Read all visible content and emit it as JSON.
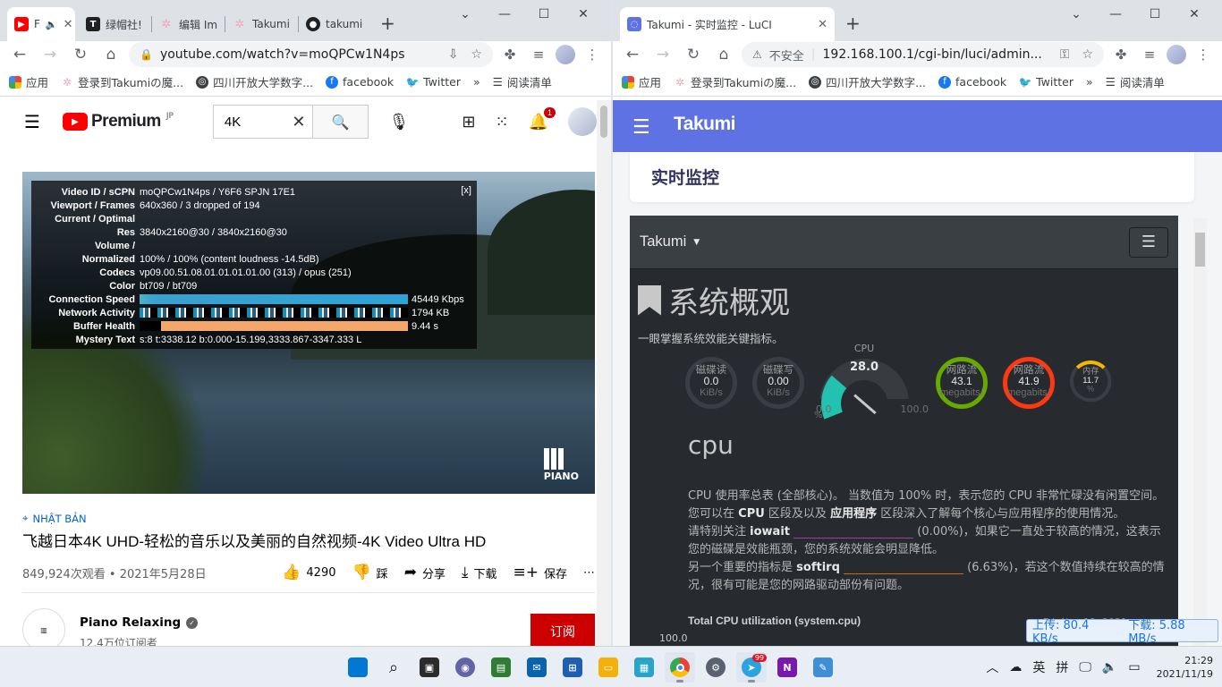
{
  "left_browser": {
    "tabs": [
      {
        "label": "F",
        "favicon_color": "#ff0000"
      },
      {
        "label": "绿帽社!",
        "favicon_color": "#202124"
      },
      {
        "label": "编辑 Im",
        "favicon_color": "#f4a7b9"
      },
      {
        "label": "Takumi",
        "favicon_color": "#f4a7b9"
      },
      {
        "label": "takumi",
        "favicon_color": "#202124"
      }
    ],
    "url": "youtube.com/watch?v=moQPCw1N4ps",
    "bookmarks": [
      "应用",
      "登录到Takumiの魔...",
      "四川开放大学数字...",
      "facebook",
      "Twitter"
    ],
    "reading_list": "阅读清单"
  },
  "youtube": {
    "logo_text": "Premium",
    "logo_region": "JP",
    "search_value": "4K",
    "notification_count": "1",
    "stats": [
      {
        "label": "Video ID / sCPN",
        "value": "moQPCw1N4ps / Y6F6 SPJN 17E1"
      },
      {
        "label": "Viewport / Frames",
        "value": "640x360 / 3 dropped of 194"
      },
      {
        "label": "Current / Optimal",
        "value": ""
      },
      {
        "label": "Res",
        "value": "3840x2160@30 / 3840x2160@30"
      },
      {
        "label": "Volume /",
        "value": ""
      },
      {
        "label": "Normalized",
        "value": "100% / 100% (content loudness -14.5dB)"
      },
      {
        "label": "Codecs",
        "value": "vp09.00.51.08.01.01.01.01.00 (313) / opus (251)"
      },
      {
        "label": "Color",
        "value": "bt709 / bt709"
      },
      {
        "label": "Connection Speed",
        "value": "45449 Kbps",
        "bar": "conn"
      },
      {
        "label": "Network Activity",
        "value": "1794 KB",
        "bar": "net"
      },
      {
        "label": "Buffer Health",
        "value": "9.44 s",
        "bar": "buf"
      },
      {
        "label": "Mystery Text",
        "value": "s:8 t:3338.12 b:0.000-15.199,3333.867-3347.333 L"
      }
    ],
    "stats_close": "[x]",
    "watermark": "PIANO",
    "location": "NHẬT BẢN",
    "title": "飞越日本4K UHD-轻松的音乐以及美丽的自然视频-4K Video Ultra HD",
    "views_date": "849,924次观看 • 2021年5月28日",
    "likes": "4290",
    "dislike_label": "踩",
    "share_label": "分享",
    "download_label": "下载",
    "save_label": "保存",
    "channel_name": "Piano Relaxing",
    "channel_subs": "12.4万位订阅者",
    "subscribe_label": "订阅"
  },
  "right_browser": {
    "tab_title": "Takumi - 实时监控 - LuCI",
    "not_secure": "不安全",
    "url": "192.168.100.1/cgi-bin/luci/admin...",
    "bookmarks": [
      "应用",
      "登录到Takumiの魔...",
      "四川开放大学数字...",
      "facebook",
      "Twitter"
    ],
    "reading_list": "阅读清单"
  },
  "luci": {
    "brand": "Takumi",
    "page_title": "实时监控",
    "netdata_brand": "Takumi",
    "overview_title": "系统概观",
    "overview_sub": "一眼掌握系统效能关键指标。",
    "gauges": [
      {
        "label": "磁碟读",
        "value": "0.0",
        "unit": "KiB/s",
        "color": "#555555"
      },
      {
        "label": "磁碟写",
        "value": "0.00",
        "unit": "KiB/s",
        "color": "#555555"
      },
      {
        "label": "网路流",
        "value": "43.1",
        "unit": "megabits/",
        "color": "#66aa00"
      },
      {
        "label": "网路流",
        "value": "41.9",
        "unit": "megabits/",
        "color": "#fe3912"
      },
      {
        "label": "内存",
        "value": "11.7",
        "unit": "%",
        "color": "#f5b800"
      }
    ],
    "cpu_gauge": {
      "label": "CPU",
      "value": "28.0",
      "min": "0.0",
      "max": "100.0",
      "unit": "%",
      "fill_pct": 28,
      "color": "#22c1b0"
    },
    "section_title": "cpu",
    "desc_1": "CPU 使用率总表 (全部核心)。 当数值为 100% 时，表示您的 CPU 非常忙碌没有闲置空间。您可以在",
    "desc_cpu_link": "CPU",
    "desc_2": "区段及以及",
    "desc_app_link": "应用程序",
    "desc_3": "区段深入了解每个核心与应用程序的使用情况。",
    "iowait_pre": "请特别关注",
    "iowait_label": "iowait",
    "iowait_value": "0.00%",
    "iowait_post": "，如果它一直处于较高的情况，这表示您的磁碟是效能瓶颈，您的系统效能会明显降低。",
    "softirq_pre": "另一个重要的指标是",
    "softirq_label": "softirq",
    "softirq_value": "6.63%",
    "softirq_post": "，若这个数值持续在较高的情况，很有可能是您的网路驱动部份有问题。",
    "chart_title": "Total CPU utilization (system.cpu)",
    "chart_y": "100.0",
    "chart_date": "Fri, Nov 19, 2021"
  },
  "speed": {
    "upload": "上传: 80.4 KB/s",
    "download": "下载: 5.88 MB/s"
  },
  "taskbar": {
    "tray_lang": "英",
    "tray_ime": "拼",
    "time": "21:29",
    "date": "2021/11/19",
    "telegram_badge": "99"
  }
}
